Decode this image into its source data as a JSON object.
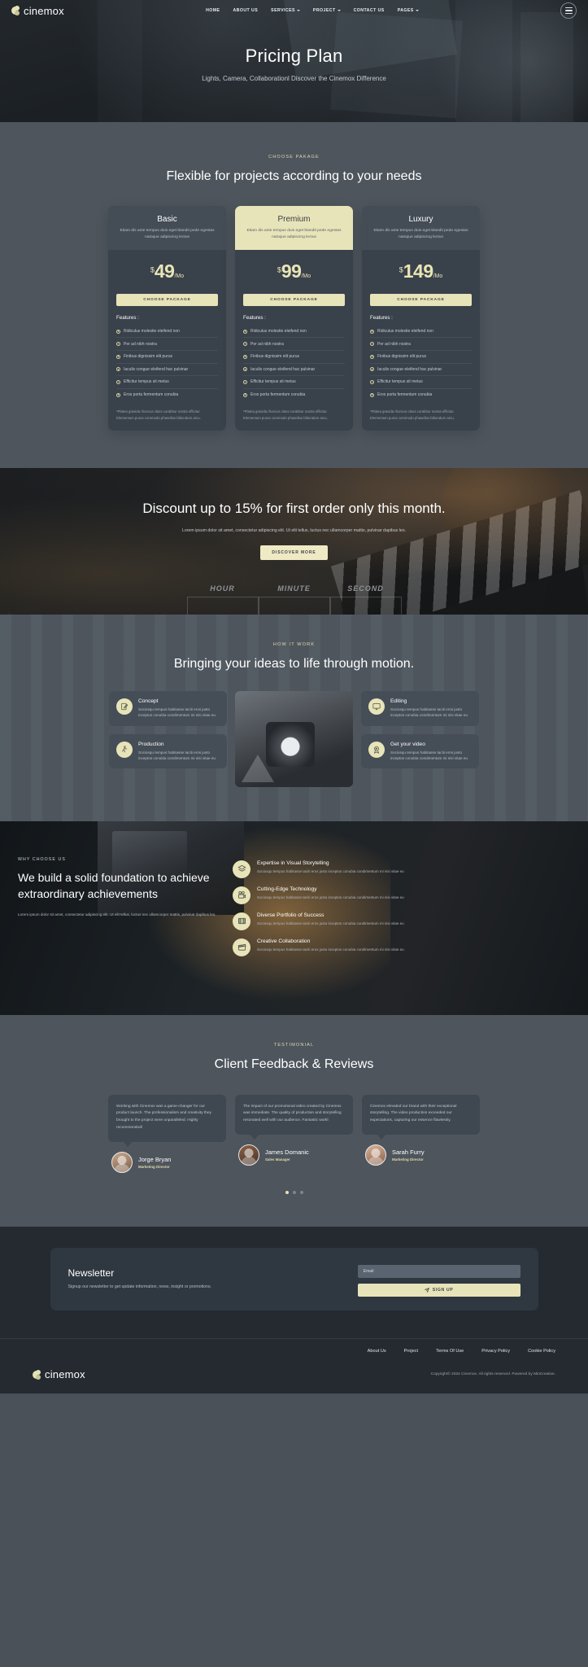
{
  "header": {
    "brand": "cinemox",
    "nav": [
      {
        "label": "HOME",
        "caret": false
      },
      {
        "label": "ABOUT US",
        "caret": false
      },
      {
        "label": "SERVICES",
        "caret": true
      },
      {
        "label": "PROJECT",
        "caret": true
      },
      {
        "label": "CONTACT US",
        "caret": false
      },
      {
        "label": "PAGES",
        "caret": true
      }
    ]
  },
  "hero": {
    "title": "Pricing Plan",
    "subtitle": "Lights, Camera, Collaborationl Discover the Cinemox Difference"
  },
  "pricing": {
    "eyebrow": "CHOOSE PAKAGE",
    "title": "Flexible for projects according to your needs",
    "features_label": "Features :",
    "button_label": "CHOOSE PACKAGE",
    "note": "*Platea gravida rhoncus class curabitur nostra efficitur. Elementum purus commodo phasellus bibendum arcu.",
    "desc": "Etiam dis ante tempus duis eget blandit pede egestas natoque adipiscing lectus",
    "features": [
      "Ridiculus molestie eleifend non",
      "Per ad nibh nostra",
      "Finibus dignissim elit purus",
      "Iaculis congue eleifend hac pulvinar",
      "Efficitur tempus sit metus",
      "Eros porta fermentum conubia"
    ],
    "plans": [
      {
        "name": "Basic",
        "currency": "$",
        "amount": "49",
        "period": "/Mo",
        "featured": false
      },
      {
        "name": "Premium",
        "currency": "$",
        "amount": "99",
        "period": "/Mo",
        "featured": true
      },
      {
        "name": "Luxury",
        "currency": "$",
        "amount": "149",
        "period": "/Mo",
        "featured": false
      }
    ]
  },
  "discount": {
    "title": "Discount up to 15% for first order only this month.",
    "text": "Lorem ipsum dolor sit amet, consectetur adipiscing elit. Ut elit tellus, luctus nec ullamcorper mattis, pulvinar dapibus leo.",
    "button": "DISCOVER MORE",
    "counter": [
      "HOUR",
      "MINUTE",
      "SECOND"
    ]
  },
  "how": {
    "eyebrow": "HOW IT WORK",
    "title": "Bringing your ideas to life through motion.",
    "body": "Sociosqu tempus habitasse taciti eros justo inceptos conubia condimentum mi nisi vitae eu",
    "cards": [
      {
        "title": "Concept",
        "icon": "pencil-note-icon"
      },
      {
        "title": "Production",
        "icon": "person-run-icon"
      },
      {
        "title": "Editing",
        "icon": "monitor-icon"
      },
      {
        "title": "Get your video",
        "icon": "video-badge-icon"
      }
    ]
  },
  "why": {
    "eyebrow": "WHY CHOOSE US",
    "title": "We build a solid foundation to achieve extraordinary achievements",
    "text": "Lorem ipsum dolor sit amet, consectetur adipiscing elit. Ut elit tellus, luctus nec ullamcorper mattis, pulvinar dapibus leo.",
    "body": "Sociosqu tempus habitasse taciti eros justo inceptos conubia condimentum mi nisi vitae eu",
    "items": [
      {
        "title": "Expertise in Visual Storytelling",
        "icon": "layers-icon"
      },
      {
        "title": "Cutting-Edge Technology",
        "icon": "film-camera-icon"
      },
      {
        "title": "Diverse Portfolio of Success",
        "icon": "film-strip-icon"
      },
      {
        "title": "Creative Collaboration",
        "icon": "clapper-icon"
      }
    ]
  },
  "testimonial": {
    "eyebrow": "TESTIMONIAL",
    "title": "Client Feedback & Reviews",
    "cards": [
      {
        "text": "Working with Cinemox was a game-changer for our product launch. The professionalism and creativity they brought to the project were unparalleled. Highly recommendedl",
        "name": "Jorge Bryan",
        "role": "Marketing Director"
      },
      {
        "text": "The impact of our promotional video created by Cinemox was immediate. The quality of production and storytelling resonated well with our audience. Fantastic workl",
        "name": "James Domanic",
        "role": "Sales Manager"
      },
      {
        "text": "Cinemox elevated our brand with their exceptional storytelling. The video production exceeded our expectations, capturing our essence flawlessly.",
        "name": "Sarah Furry",
        "role": "Marketing Director"
      }
    ],
    "dots": 3
  },
  "newsletter": {
    "title": "Newsletter",
    "text": "Signup our newsletter to get update information, news, insight or promotions.",
    "placeholder": "Email",
    "button": "SIGN UP"
  },
  "footer": {
    "brand": "cinemox",
    "links": [
      "About Us",
      "Project",
      "Terms Of Use",
      "Privacy Policy",
      "Cookie Policy"
    ],
    "copyright": "Copyright© 2024 Cinemox. All rights reserved. Powered by MioCreative."
  }
}
